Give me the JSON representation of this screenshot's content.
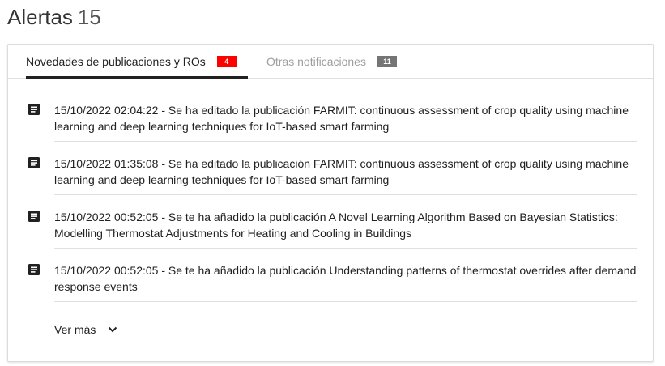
{
  "header": {
    "title": "Alertas",
    "count": "15"
  },
  "tabs": [
    {
      "label": "Novedades de publicaciones y ROs",
      "badge": "4",
      "badge_color": "#ff0000"
    },
    {
      "label": "Otras notificaciones",
      "badge": "11",
      "badge_color": "#757575"
    }
  ],
  "notifications": [
    {
      "icon": "document-icon",
      "text": "15/10/2022 02:04:22 - Se ha editado la publicación FARMIT: continuous assessment of crop quality using machine learning and deep learning techniques for IoT-based smart farming"
    },
    {
      "icon": "document-icon",
      "text": "15/10/2022 01:35:08 - Se ha editado la publicación FARMIT: continuous assessment of crop quality using machine learning and deep learning techniques for IoT-based smart farming"
    },
    {
      "icon": "document-icon",
      "text": "15/10/2022 00:52:05 - Se te ha añadido la publicación A Novel Learning Algorithm Based on Bayesian Statistics: Modelling Thermostat Adjustments for Heating and Cooling in Buildings"
    },
    {
      "icon": "document-icon",
      "text": "15/10/2022 00:52:05 - Se te ha añadido la publicación Understanding patterns of thermostat overrides after demand response events"
    }
  ],
  "more": {
    "label": "Ver más",
    "icon": "chevron-down-icon"
  }
}
